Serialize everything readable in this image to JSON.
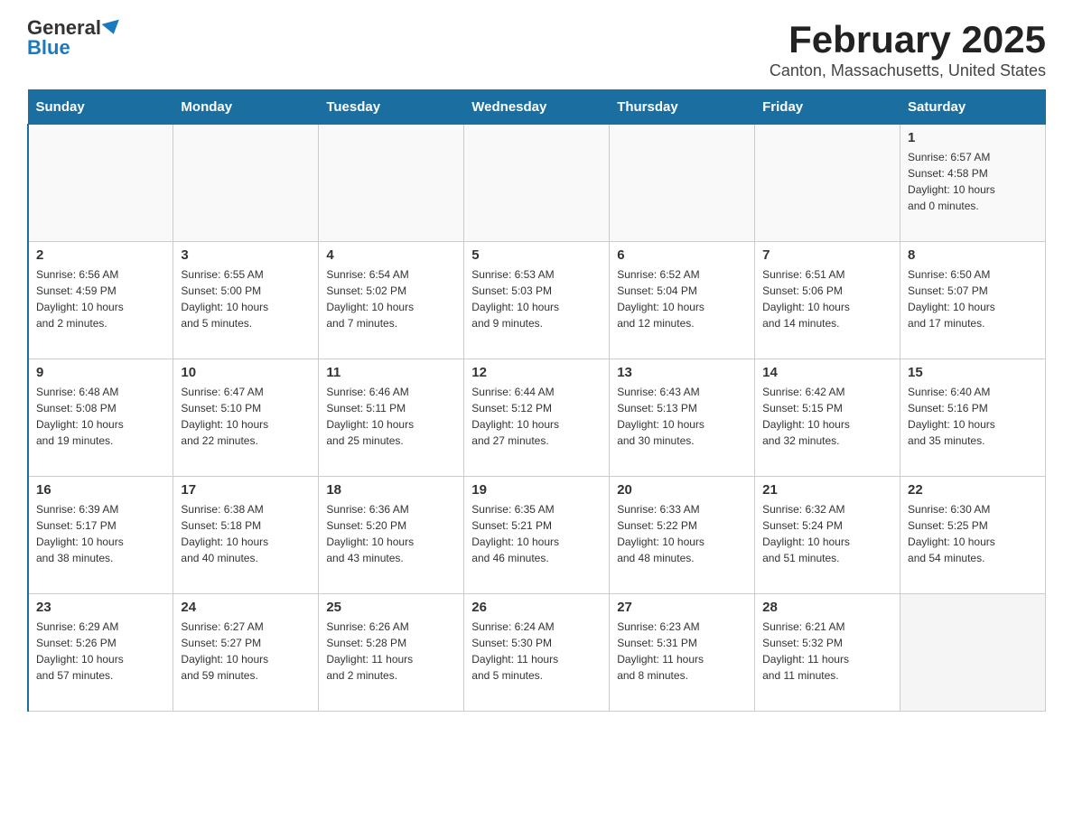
{
  "header": {
    "logo_general": "General",
    "logo_blue": "Blue",
    "month_title": "February 2025",
    "location": "Canton, Massachusetts, United States"
  },
  "days_of_week": [
    "Sunday",
    "Monday",
    "Tuesday",
    "Wednesday",
    "Thursday",
    "Friday",
    "Saturday"
  ],
  "weeks": [
    [
      {
        "day": "",
        "info": ""
      },
      {
        "day": "",
        "info": ""
      },
      {
        "day": "",
        "info": ""
      },
      {
        "day": "",
        "info": ""
      },
      {
        "day": "",
        "info": ""
      },
      {
        "day": "",
        "info": ""
      },
      {
        "day": "1",
        "info": "Sunrise: 6:57 AM\nSunset: 4:58 PM\nDaylight: 10 hours\nand 0 minutes."
      }
    ],
    [
      {
        "day": "2",
        "info": "Sunrise: 6:56 AM\nSunset: 4:59 PM\nDaylight: 10 hours\nand 2 minutes."
      },
      {
        "day": "3",
        "info": "Sunrise: 6:55 AM\nSunset: 5:00 PM\nDaylight: 10 hours\nand 5 minutes."
      },
      {
        "day": "4",
        "info": "Sunrise: 6:54 AM\nSunset: 5:02 PM\nDaylight: 10 hours\nand 7 minutes."
      },
      {
        "day": "5",
        "info": "Sunrise: 6:53 AM\nSunset: 5:03 PM\nDaylight: 10 hours\nand 9 minutes."
      },
      {
        "day": "6",
        "info": "Sunrise: 6:52 AM\nSunset: 5:04 PM\nDaylight: 10 hours\nand 12 minutes."
      },
      {
        "day": "7",
        "info": "Sunrise: 6:51 AM\nSunset: 5:06 PM\nDaylight: 10 hours\nand 14 minutes."
      },
      {
        "day": "8",
        "info": "Sunrise: 6:50 AM\nSunset: 5:07 PM\nDaylight: 10 hours\nand 17 minutes."
      }
    ],
    [
      {
        "day": "9",
        "info": "Sunrise: 6:48 AM\nSunset: 5:08 PM\nDaylight: 10 hours\nand 19 minutes."
      },
      {
        "day": "10",
        "info": "Sunrise: 6:47 AM\nSunset: 5:10 PM\nDaylight: 10 hours\nand 22 minutes."
      },
      {
        "day": "11",
        "info": "Sunrise: 6:46 AM\nSunset: 5:11 PM\nDaylight: 10 hours\nand 25 minutes."
      },
      {
        "day": "12",
        "info": "Sunrise: 6:44 AM\nSunset: 5:12 PM\nDaylight: 10 hours\nand 27 minutes."
      },
      {
        "day": "13",
        "info": "Sunrise: 6:43 AM\nSunset: 5:13 PM\nDaylight: 10 hours\nand 30 minutes."
      },
      {
        "day": "14",
        "info": "Sunrise: 6:42 AM\nSunset: 5:15 PM\nDaylight: 10 hours\nand 32 minutes."
      },
      {
        "day": "15",
        "info": "Sunrise: 6:40 AM\nSunset: 5:16 PM\nDaylight: 10 hours\nand 35 minutes."
      }
    ],
    [
      {
        "day": "16",
        "info": "Sunrise: 6:39 AM\nSunset: 5:17 PM\nDaylight: 10 hours\nand 38 minutes."
      },
      {
        "day": "17",
        "info": "Sunrise: 6:38 AM\nSunset: 5:18 PM\nDaylight: 10 hours\nand 40 minutes."
      },
      {
        "day": "18",
        "info": "Sunrise: 6:36 AM\nSunset: 5:20 PM\nDaylight: 10 hours\nand 43 minutes."
      },
      {
        "day": "19",
        "info": "Sunrise: 6:35 AM\nSunset: 5:21 PM\nDaylight: 10 hours\nand 46 minutes."
      },
      {
        "day": "20",
        "info": "Sunrise: 6:33 AM\nSunset: 5:22 PM\nDaylight: 10 hours\nand 48 minutes."
      },
      {
        "day": "21",
        "info": "Sunrise: 6:32 AM\nSunset: 5:24 PM\nDaylight: 10 hours\nand 51 minutes."
      },
      {
        "day": "22",
        "info": "Sunrise: 6:30 AM\nSunset: 5:25 PM\nDaylight: 10 hours\nand 54 minutes."
      }
    ],
    [
      {
        "day": "23",
        "info": "Sunrise: 6:29 AM\nSunset: 5:26 PM\nDaylight: 10 hours\nand 57 minutes."
      },
      {
        "day": "24",
        "info": "Sunrise: 6:27 AM\nSunset: 5:27 PM\nDaylight: 10 hours\nand 59 minutes."
      },
      {
        "day": "25",
        "info": "Sunrise: 6:26 AM\nSunset: 5:28 PM\nDaylight: 11 hours\nand 2 minutes."
      },
      {
        "day": "26",
        "info": "Sunrise: 6:24 AM\nSunset: 5:30 PM\nDaylight: 11 hours\nand 5 minutes."
      },
      {
        "day": "27",
        "info": "Sunrise: 6:23 AM\nSunset: 5:31 PM\nDaylight: 11 hours\nand 8 minutes."
      },
      {
        "day": "28",
        "info": "Sunrise: 6:21 AM\nSunset: 5:32 PM\nDaylight: 11 hours\nand 11 minutes."
      },
      {
        "day": "",
        "info": ""
      }
    ]
  ]
}
